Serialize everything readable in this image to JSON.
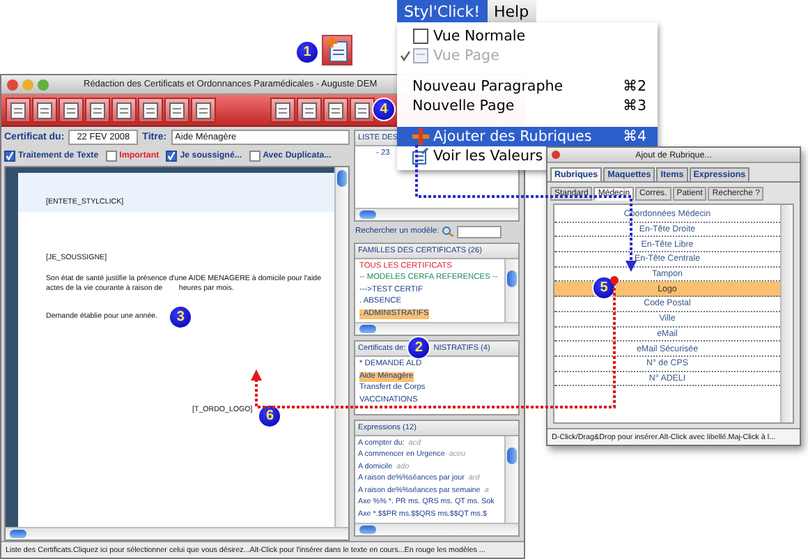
{
  "callouts": [
    {
      "number": "1"
    },
    {
      "number": "2"
    },
    {
      "number": "3"
    },
    {
      "number": "4"
    },
    {
      "number": "5"
    },
    {
      "number": "6"
    }
  ],
  "main_window": {
    "title": "Rédaction des Certificats et Ordonnances Paramédicales - Auguste DEM",
    "date_label": "Certificat du:",
    "date": "22 FEV 2008",
    "title_label": "Titre:",
    "title_value": "Aide Ménagère",
    "options": [
      {
        "label": "Traitement de Texte",
        "checked": true,
        "color": "#1c3f8a"
      },
      {
        "label": "Important",
        "checked": false,
        "color": "#e0202a"
      },
      {
        "label": "Je soussigné...",
        "checked": true,
        "color": "#1c3f8a"
      },
      {
        "label": "Avec Duplicata...",
        "checked": false,
        "color": "#1c3f8a"
      }
    ],
    "document": [
      {
        "kind": "header",
        "text": "[ENTETE_STYLCLICK]"
      },
      {
        "kind": "paragraph",
        "lines": [
          "[JE_SOUSSIGNE]"
        ]
      },
      {
        "kind": "paragraph",
        "lines": [
          "Son état de santé justifie la présence d'une AIDE MENAGERE à domicile pour l'aide",
          "actes de la vie courante à raison de        heures par mois."
        ]
      },
      {
        "kind": "paragraph",
        "lines": [
          "Demande établie pour une année."
        ]
      },
      {
        "kind": "signature",
        "lines": [
          "[T_ORDO_LOGO]"
        ]
      }
    ],
    "list_panel": {
      "title": "LISTE DES",
      "items": [
        "- 23"
      ]
    },
    "search": {
      "label": "Rechercher un modèle:"
    },
    "families": {
      "title": "FAMILLES DES CERTIFICATS (26)",
      "items": [
        {
          "label": "TOUS LES CERTIFICATS",
          "color": "#e0202a",
          "selected": false
        },
        {
          "label": "-- MODELES CERFA REFERENCES --",
          "color": "#1f8a5a",
          "selected": false
        },
        {
          "label": "--->TEST CERTIF",
          "selected": false
        },
        {
          "label": ". ABSENCE",
          "selected": false
        },
        {
          "label": ". ADMINISTRATIFS",
          "selected": true
        }
      ]
    },
    "certificates": {
      "title": "Certificats de:",
      "title_rest": "NISTRATIFS (4)",
      "items": [
        {
          "label": "* DEMANDE ALD",
          "selected": false
        },
        {
          "label": "Aide Ménagère",
          "selected": true
        },
        {
          "label": "Transfert de Corps",
          "selected": false
        },
        {
          "label": "VACCINATIONS",
          "selected": false
        }
      ]
    },
    "expressions": {
      "title": "Expressions (12)",
      "items": [
        {
          "label": "A compter du:",
          "abbr": "acd"
        },
        {
          "label": "A commencer en Urgence",
          "abbr": "aceu"
        },
        {
          "label": "A domicile",
          "abbr": "ado"
        },
        {
          "label": "A raison de%%séances par jour",
          "abbr": "ard"
        },
        {
          "label": "A raison de%%séances par semaine",
          "abbr": "a"
        },
        {
          "label": "Axe %% *. PR ms. QRS ms. QT ms. Sok"
        },
        {
          "label": "Axe  *.$$PR ms.$$QRS ms.$$QT ms.$"
        }
      ]
    },
    "status_bar": "Liste des Certificats.Cliquez ici pour sélectionner celui que vous désirez...Alt-Click pour l'insérer dans le texte en cours...En rouge les modèles ..."
  },
  "menu": {
    "bar": [
      {
        "label": "Styl'Click!",
        "selected": true
      },
      {
        "label": "Help",
        "selected": false
      }
    ],
    "items": [
      {
        "kind": "item",
        "label": "Vue Normale",
        "checked": false,
        "disabled": false,
        "selected": false
      },
      {
        "kind": "item",
        "label": "Vue Page",
        "checked": true,
        "disabled": true,
        "selected": false
      },
      {
        "kind": "separator"
      },
      {
        "kind": "item",
        "label": "Nouveau Paragraphe",
        "shortcut": "⌘2",
        "checked": false,
        "disabled": false,
        "selected": false
      },
      {
        "kind": "item",
        "label": "Nouvelle Page",
        "shortcut": "⌘3",
        "checked": false,
        "disabled": false,
        "selected": false
      },
      {
        "kind": "separator"
      },
      {
        "kind": "item",
        "label": "Ajouter des Rubriques",
        "shortcut": "⌘4",
        "checked": false,
        "disabled": false,
        "selected": true
      },
      {
        "kind": "item",
        "label": "Voir les Valeurs",
        "checked": false,
        "disabled": false,
        "selected": false
      }
    ]
  },
  "dialog": {
    "title": "Ajout de Rubrique...",
    "tabs": [
      {
        "label": "Rubriques",
        "selected": true
      },
      {
        "label": "Maquettes",
        "selected": false
      },
      {
        "label": "Items",
        "selected": false
      },
      {
        "label": "Expressions",
        "selected": false
      }
    ],
    "subtabs": [
      {
        "label": "Standard",
        "selected": false
      },
      {
        "label": "Médecin",
        "selected": true
      },
      {
        "label": "Corres.",
        "selected": false
      },
      {
        "label": "Patient",
        "selected": false
      },
      {
        "label": "Recherche ?",
        "selected": false
      }
    ],
    "items": [
      {
        "label": "Coordonnées Médecin",
        "selected": false
      },
      {
        "label": "En-Tête Droite",
        "selected": false
      },
      {
        "label": "En-Tête Libre",
        "selected": false
      },
      {
        "label": "En-Tête Centrale",
        "selected": false
      },
      {
        "label": "Tampon",
        "selected": false
      },
      {
        "label": "Logo",
        "selected": true
      },
      {
        "label": "Code Postal",
        "selected": false
      },
      {
        "label": "Ville",
        "selected": false
      },
      {
        "label": "eMail",
        "selected": false
      },
      {
        "label": "eMail Sécurisée",
        "selected": false
      },
      {
        "label": "N° de CPS",
        "selected": false
      },
      {
        "label": "N° ADELI",
        "selected": false
      }
    ],
    "status": "D-Click/Drag&Drop pour insérer.Alt-Click avec libellé.Maj-Click à l..."
  }
}
